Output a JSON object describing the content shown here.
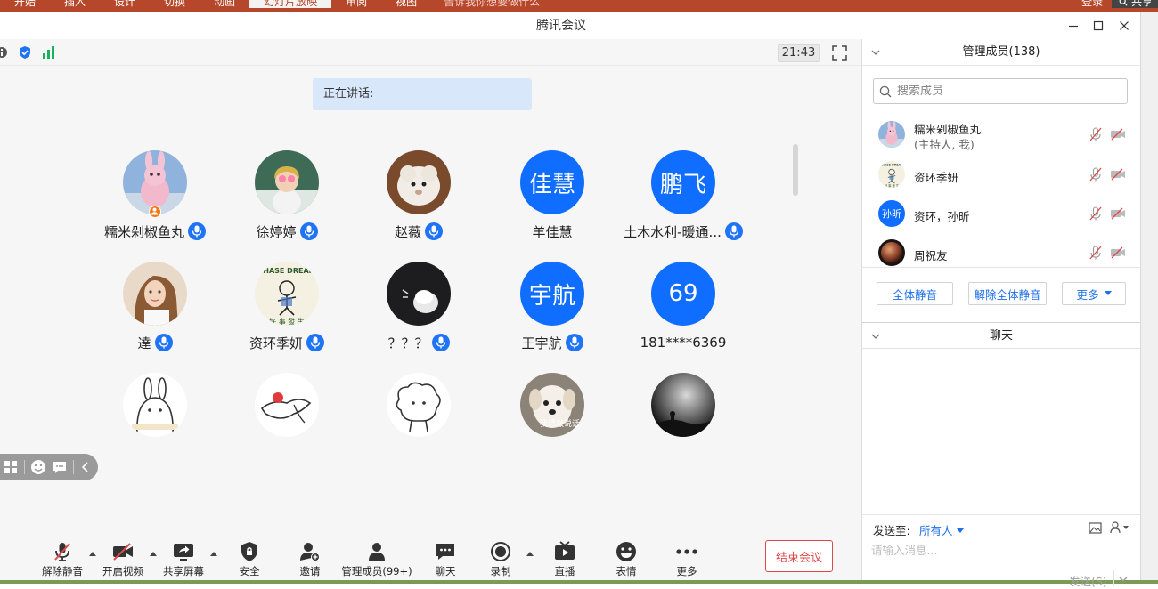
{
  "ppt": {
    "tabs": [
      "开始",
      "插入",
      "设计",
      "切换",
      "动画",
      "幻灯片放映",
      "审阅",
      "视图"
    ],
    "active_tab": "幻灯片放映",
    "search_placeholder": "告诉我你想要做什么",
    "login": "登录",
    "share": "共享"
  },
  "window": {
    "title": "腾讯会议"
  },
  "meeting": {
    "time": "21:43",
    "speaking_label": "正在讲话:"
  },
  "participants": [
    {
      "name": "糯米剁椒鱼丸",
      "avatar": "pink-rabbit-photo",
      "mic": true,
      "host_badge": true
    },
    {
      "name": "徐婷婷",
      "avatar": "girl-photo",
      "mic": true
    },
    {
      "name": "赵薇",
      "avatar": "sheep-photo",
      "mic": true
    },
    {
      "name": "羊佳慧",
      "avatar_text": "佳慧",
      "mic": false
    },
    {
      "name": "土木水利-暖通...",
      "avatar_text": "鹏飞",
      "mic": true
    },
    {
      "name": "達",
      "avatar": "woman-photo",
      "mic": true
    },
    {
      "name": "资环季妍",
      "avatar": "cartoon-poster",
      "mic": true
    },
    {
      "name": "？？？",
      "avatar": "dark-fluffy-photo",
      "mic": true
    },
    {
      "name": "王宇航",
      "avatar_text": "宇航",
      "mic": true
    },
    {
      "name": "181****6369",
      "avatar_text": "69",
      "mic": false
    },
    {
      "name": "",
      "avatar": "rabbit-sketch"
    },
    {
      "name": "",
      "avatar": "bird-sketch"
    },
    {
      "name": "",
      "avatar": "sheep-sketch"
    },
    {
      "name": "",
      "avatar": "puppy-photo",
      "avatar_caption": "我想敲说话"
    },
    {
      "name": "",
      "avatar": "moody-silhouette"
    }
  ],
  "toolbar": {
    "unmute": "解除静音",
    "start_video": "开启视频",
    "share_screen": "共享屏幕",
    "security": "安全",
    "invite": "邀请",
    "manage_members": "管理成员(99+)",
    "chat": "聊天",
    "record": "录制",
    "live": "直播",
    "emoji": "表情",
    "more": "更多",
    "end_meeting": "结束会议"
  },
  "members_panel": {
    "title": "管理成员(138)",
    "search_placeholder": "搜索成员",
    "members": [
      {
        "name": "糯米剁椒鱼丸",
        "sub": "(主持人, 我)",
        "avatar": "pink-rabbit-photo"
      },
      {
        "name": "资环季妍",
        "avatar": "cartoon-poster"
      },
      {
        "name": "资环，孙昕",
        "avatar_text": "孙昕"
      },
      {
        "name": "周祝友",
        "avatar": "planet-photo"
      }
    ],
    "mute_all": "全体静音",
    "unmute_all": "解除全体静音",
    "more": "更多"
  },
  "chat_panel": {
    "title": "聊天",
    "send_to_label": "发送至:",
    "send_to_value": "所有人",
    "input_placeholder": "请输入消息...",
    "send_label": "发送(S)"
  },
  "colors": {
    "accent": "#1e6fe8",
    "avatar_blue": "#0f6dff",
    "end_red": "#e04848",
    "ppt_red": "#b7472a"
  }
}
